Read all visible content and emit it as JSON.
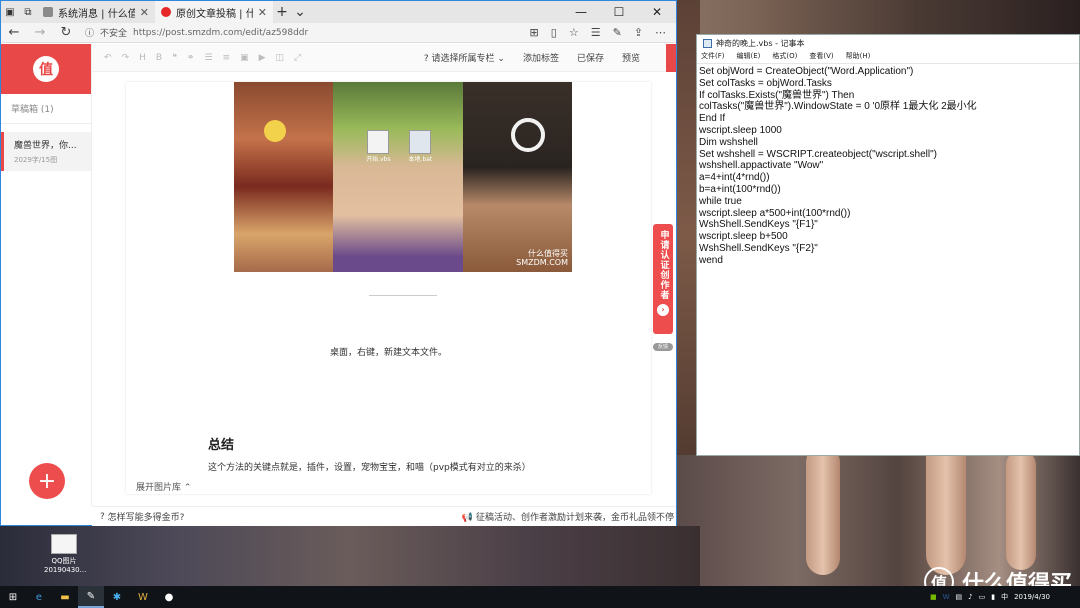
{
  "browser": {
    "tabs": [
      {
        "title": "系统消息 | 什么值得买"
      },
      {
        "title": "原创文章投稿 | 什么值得"
      }
    ],
    "address": {
      "security": "不安全",
      "url": "https://post.smzdm.com/edit/az598ddr"
    },
    "sidebar": {
      "logo": "值",
      "drafts_label": "草稿箱 (1)",
      "draft_title": "魔兽世界，你...",
      "draft_date": "2029字/15图"
    },
    "toolbar": {
      "column_select": "请选择所属专栏",
      "add_tag": "添加标签",
      "saved": "已保存",
      "preview": "预览"
    },
    "editor": {
      "photo_icon1": "开始.vbs",
      "photo_icon2": "本地.bat",
      "photo_watermark1": "什么值得买",
      "photo_watermark2": "SMZDM.COM",
      "caption": "桌面，右键，新建文本文件。",
      "heading": "总结",
      "paragraph": "这个方法的关键点就是，插件，设置，宠物宝宝，和喵（pvp模式有对立的来杀）",
      "expand": "展开图片库 ⌃"
    },
    "apply_badge": "申请认证创作者",
    "feedback": "反馈",
    "statusbar": {
      "help": "怎样写能多得金币?",
      "notice": "征稿活动、创作者激励计划来袭，金币礼品领不停"
    }
  },
  "notepad": {
    "title": "神奇的晚上.vbs - 记事本",
    "menu": [
      "文件(F)",
      "编辑(E)",
      "格式(O)",
      "查看(V)",
      "帮助(H)"
    ],
    "content": "Set objWord = CreateObject(\"Word.Application\")\nSet colTasks = objWord.Tasks\nIf colTasks.Exists(\"魔兽世界\") Then\ncolTasks(\"魔兽世界\").WindowState = 0 '0原样 1最大化 2最小化\nEnd If\nwscript.sleep 1000\nDim wshshell\nSet wshshell = WSCRIPT.createobject(\"wscript.shell\")\nwshshell.appactivate \"Wow\"\na=4+int(4*rnd())\nb=a+int(100*rnd())\nwhile true\nwscript.sleep a*500+int(100*rnd())\nWshShell.SendKeys \"{F1}\"\nwscript.sleep b+500\nWshShell.SendKeys \"{F2}\"\nwend"
  },
  "desktop": {
    "file_name": "QQ图片\n20190430...",
    "brand_logo": "值",
    "brand_text": "什么值得买"
  },
  "taskbar": {
    "ime": "中",
    "time": "",
    "date": "2019/4/30"
  }
}
